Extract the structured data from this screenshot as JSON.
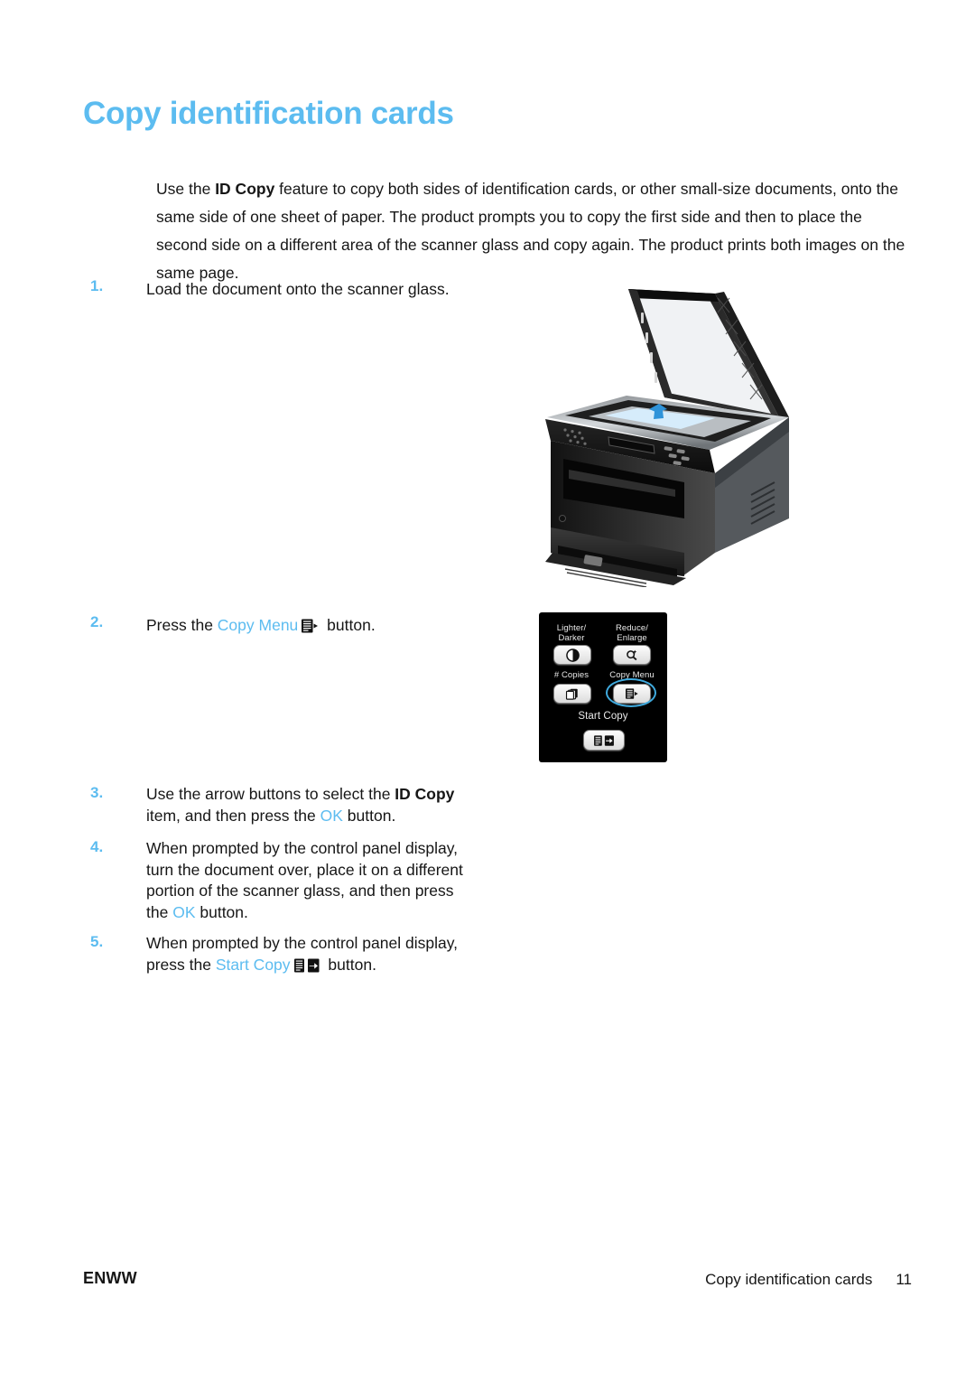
{
  "document": {
    "title": "Copy identification cards",
    "accent_color": "#5CBCF0",
    "text_color": "#161616"
  },
  "intro": {
    "part1": "Use the ",
    "bold1": "ID Copy",
    "part2": " feature to copy both sides of identification cards, or other small-size documents, onto the same side of one sheet of paper. The product prompts you to copy the first side and then to place the second side on a different area of the scanner glass and copy again. The product prints both images on the same page."
  },
  "steps": [
    {
      "number": "1.",
      "text": "Load the document onto the scanner glass."
    },
    {
      "number": "2.",
      "pre": "Press the ",
      "accent": "Copy Menu",
      "icon": "copy-menu-icon",
      "post": " button."
    },
    {
      "number": "3.",
      "pre": "Use the arrow buttons to select the ",
      "bold": "ID Copy",
      "mid": " item, and then press the ",
      "accent": "OK",
      "post": " button."
    },
    {
      "number": "4.",
      "pre": "When prompted by the control panel display, turn the document over, place it on a different portion of the scanner glass, and then press the ",
      "accent": "OK",
      "post": " button."
    },
    {
      "number": "5.",
      "pre": "When prompted by the control panel display, press the ",
      "accent": "Start Copy",
      "icon": "start-copy-icon",
      "post": " button."
    }
  ],
  "figures": {
    "printer": {
      "name": "all-in-one-printer-scanner-lid-open",
      "description": "Laser all-in-one printer with scanner lid open and a document placed on the glass"
    },
    "control_panel": {
      "name": "copy-control-panel",
      "buttons": [
        {
          "label": "Lighter/\nDarker",
          "label_line1": "Lighter/",
          "label_line2": "Darker",
          "icon": "contrast-icon"
        },
        {
          "label": "Reduce/\nEnlarge",
          "label_line1": "Reduce/",
          "label_line2": "Enlarge",
          "icon": "magnifier-icon"
        },
        {
          "label": "# Copies",
          "icon": "stacked-pages-icon"
        },
        {
          "label": "Copy Menu",
          "icon": "copy-menu-icon",
          "highlighted": true
        },
        {
          "label": "Start Copy",
          "icon": "start-copy-icon"
        }
      ],
      "highlight_color": "#3FA9DD"
    }
  },
  "footer": {
    "left": "ENWW",
    "chapter": "Copy identification cards",
    "page_number": "11"
  }
}
